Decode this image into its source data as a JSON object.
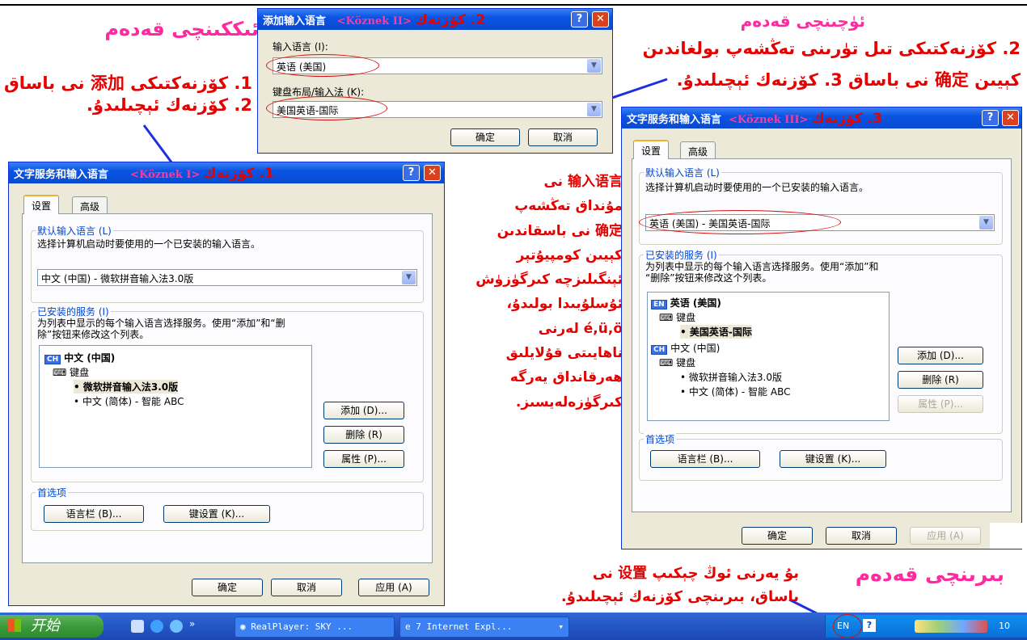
{
  "top_left": {
    "heading": "ئىككىنچى قەدەم",
    "line1": "1. كۆزنەكتىكى 添加 نى باساق",
    "line2": "2. كۆزنەك ئېچىلىدۇ."
  },
  "top_right": {
    "heading": "ئۈچىنچى قەدەم",
    "line1": "2. كۆزنەكتىكى تىل تۈرىنى تەڭشەپ بولغاندىن",
    "line2": "كېيىن 确定 نى باساق 3. كۆزنەك ئېچىلىدۇ."
  },
  "middle_note": [
    "输入语言 نى",
    "مۇنداق تەڭشەپ",
    "确定 نى باسقاندىن",
    "كېيىن كومپيۇتېر",
    "ئېنگىلىزچە كىرگۈزۈش",
    "ئۇسلۇبىدا بولىدۇ،",
    "é,ü,ö لەرنى",
    "ناھايىتى قۇلايلىق",
    "ھەرقانداق يەرگە",
    "كىرگۈزەلەيسىز."
  ],
  "bottom_note": {
    "heading": "بىرىنچى قەدەم",
    "line1": "بۇ يەرنى ئوڭ چېكىپ 设置 نى",
    "line2": "باساق، بىرىنچى كۆزنەك ئېچىلىدۇ."
  },
  "win1": {
    "title": "文字服务和输入语言",
    "tag": "<Köznek I>",
    "step": "1. كۆزنەك",
    "help": "?",
    "close": "✕",
    "tabs": [
      "设置",
      "高级"
    ],
    "default_group": "默认输入语言 (L)",
    "default_desc": "选择计算机启动时要使用的一个已安装的输入语言。",
    "default_value": "中文 (中国) - 微软拼音输入法3.0版",
    "installed_group": "已安装的服务 (I)",
    "installed_desc1": "为列表中显示的每个输入语言选择服务。使用“添加”和“删",
    "installed_desc2": "除”按钮来修改这个列表。",
    "lang_code": "CH",
    "lang_name": "中文 (中国)",
    "keyboard": "键盘",
    "item1": "微软拼音输入法3.0版",
    "item2": "中文 (简体) - 智能 ABC",
    "add": "添加 (D)...",
    "remove": "删除 (R)",
    "props": "属性 (P)...",
    "prefs_group": "首选项",
    "langbar": "语言栏 (B)...",
    "keyset": "键设置 (K)...",
    "ok": "确定",
    "cancel": "取消",
    "apply": "应用 (A)"
  },
  "win2": {
    "title": "添加输入语言",
    "tag": "<Köznek II>",
    "step": "2. كۆزنەك",
    "help": "?",
    "close": "✕",
    "lang_label": "输入语言 (I):",
    "lang_value": "英语 (美国)",
    "kbd_label": "键盘布局/输入法 (K):",
    "kbd_value": "美国英语-国际",
    "ok": "确定",
    "cancel": "取消"
  },
  "win3": {
    "title": "文字服务和输入语言",
    "tag": "<Köznek III>",
    "step": "3. كۆزنەك",
    "help": "?",
    "close": "✕",
    "tabs": [
      "设置",
      "高级"
    ],
    "default_group": "默认输入语言 (L)",
    "default_desc": "选择计算机启动时要使用的一个已安装的输入语言。",
    "default_value": "英语 (美国) - 美国英语-国际",
    "installed_group": "已安装的服务 (I)",
    "installed_desc1": "为列表中显示的每个输入语言选择服务。使用“添加”和",
    "installed_desc2": "“删除”按钮来修改这个列表。",
    "en_code": "EN",
    "en_name": "英语 (美国)",
    "keyboard": "键盘",
    "en_item": "美国英语-国际",
    "ch_code": "CH",
    "ch_name": "中文 (中国)",
    "ch_keyboard": "键盘",
    "ch_item1": "微软拼音输入法3.0版",
    "ch_item2": "中文 (简体) - 智能 ABC",
    "add": "添加 (D)...",
    "remove": "删除 (R)",
    "props": "属性 (P)...",
    "prefs_group": "首选项",
    "langbar": "语言栏 (B)...",
    "keyset": "键设置 (K)...",
    "ok": "确定",
    "cancel": "取消",
    "apply": "应用 (A)"
  },
  "taskbar": {
    "start": "开始",
    "quick_more": "»",
    "task1": "RealPlayer: SKY ...",
    "task2": "7 Internet Expl...",
    "lang": "EN",
    "help": "?",
    "clock": "10"
  }
}
